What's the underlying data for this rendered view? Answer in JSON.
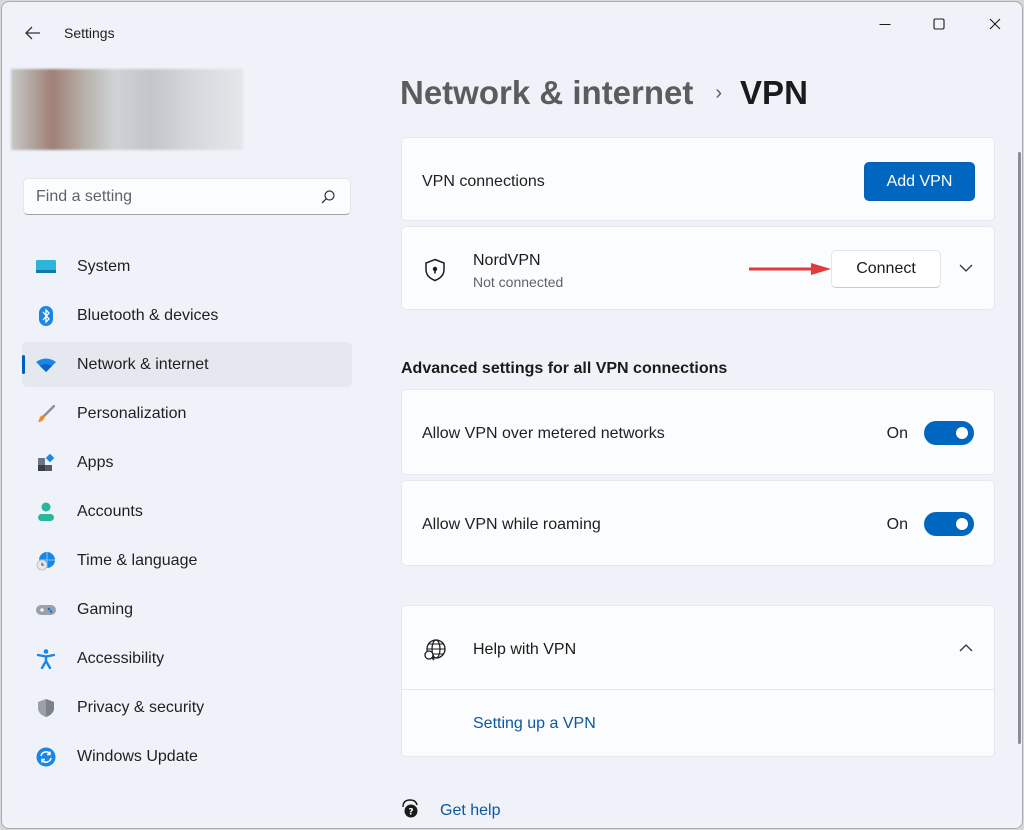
{
  "window": {
    "title": "Settings",
    "controls": {
      "minimize": "minimize-icon",
      "maximize": "maximize-icon",
      "close": "close-icon"
    }
  },
  "search": {
    "placeholder": "Find a setting",
    "value": ""
  },
  "sidebar": {
    "items": [
      {
        "label": "System",
        "icon": "system-icon",
        "active": false
      },
      {
        "label": "Bluetooth & devices",
        "icon": "bluetooth-icon",
        "active": false
      },
      {
        "label": "Network & internet",
        "icon": "wifi-icon",
        "active": true
      },
      {
        "label": "Personalization",
        "icon": "brush-icon",
        "active": false
      },
      {
        "label": "Apps",
        "icon": "apps-icon",
        "active": false
      },
      {
        "label": "Accounts",
        "icon": "account-icon",
        "active": false
      },
      {
        "label": "Time & language",
        "icon": "time-language-icon",
        "active": false
      },
      {
        "label": "Gaming",
        "icon": "gamepad-icon",
        "active": false
      },
      {
        "label": "Accessibility",
        "icon": "accessibility-icon",
        "active": false
      },
      {
        "label": "Privacy & security",
        "icon": "shield-icon",
        "active": false
      },
      {
        "label": "Windows Update",
        "icon": "update-icon",
        "active": false
      }
    ]
  },
  "breadcrumb": {
    "parent": "Network & internet",
    "separator": "›",
    "current": "VPN"
  },
  "vpn_connections": {
    "label": "VPN connections",
    "add_button": "Add VPN"
  },
  "vpn_entry": {
    "name": "NordVPN",
    "status": "Not connected",
    "connect_button": "Connect"
  },
  "advanced": {
    "title": "Advanced settings for all VPN connections",
    "settings": [
      {
        "label": "Allow VPN over metered networks",
        "state": "On",
        "enabled": true
      },
      {
        "label": "Allow VPN while roaming",
        "state": "On",
        "enabled": true
      }
    ]
  },
  "help": {
    "title": "Help with VPN",
    "links": [
      "Setting up a VPN"
    ]
  },
  "footer": {
    "get_help": "Get help"
  },
  "colors": {
    "accent": "#0067c0",
    "link": "#0b56a6",
    "annotation_arrow": "#e03a3a",
    "background": "#eff3f9"
  }
}
